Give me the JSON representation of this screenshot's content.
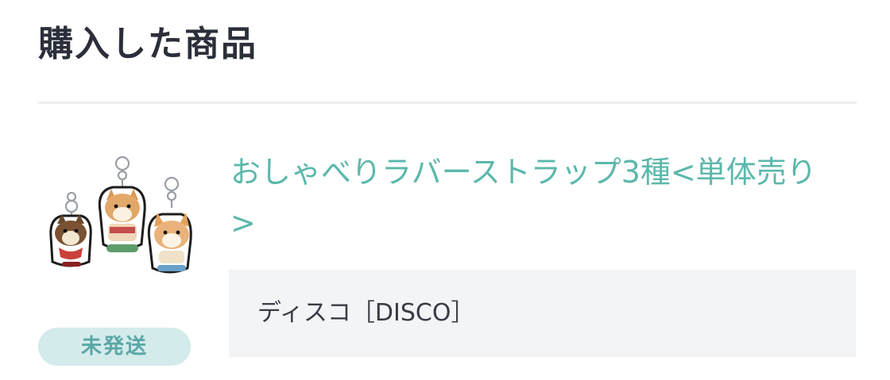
{
  "section": {
    "title": "購入した商品"
  },
  "item": {
    "name": "おしゃべりラバーストラップ3種<単体売り>",
    "variant": "ディスコ［DISCO］",
    "status": "未発送",
    "image_icon": "rubber-strap-keychains-image"
  },
  "colors": {
    "link": "#5cb8ab",
    "badge_bg": "#d4ebec",
    "badge_text": "#5aa7a6",
    "variant_bg": "#f3f4f6",
    "title": "#2b2f3a"
  }
}
